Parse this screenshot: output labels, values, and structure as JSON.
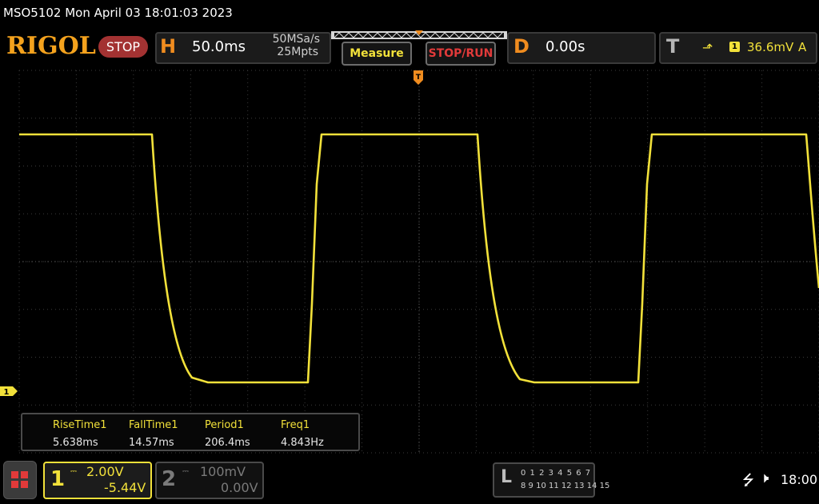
{
  "header": {
    "title": "MSO5102  Mon April 03 18:01:03 2023",
    "logo": "RIGOL",
    "run_state": "STOP"
  },
  "horizontal": {
    "letter": "H",
    "timebase": "50.0ms",
    "sample_rate": "50MSa/s",
    "memory_depth": "25Mpts"
  },
  "buttons": {
    "measure": "Measure",
    "stop_run": "STOP/RUN"
  },
  "delay": {
    "letter": "D",
    "value": "0.00s"
  },
  "trigger": {
    "letter": "T",
    "slope_icon": "rising-edge-icon",
    "slope_glyph": "⬏",
    "source": "1",
    "level": "36.6mV",
    "mode": "A"
  },
  "screen": {
    "ch1_marker": "1",
    "trigger_marker": "T",
    "trace_color": "#f2e13a"
  },
  "measurements": [
    {
      "name": "RiseTime1",
      "value": "5.638ms"
    },
    {
      "name": "FallTime1",
      "value": "14.57ms"
    },
    {
      "name": "Period1",
      "value": "206.4ms"
    },
    {
      "name": "Freq1",
      "value": "4.843Hz"
    }
  ],
  "channels": {
    "ch1": {
      "number": "1",
      "coupling": "⎓",
      "scale": "2.00V",
      "offset": "-5.44V",
      "color": "#f2e13a"
    },
    "ch2": {
      "number": "2",
      "coupling": "⎓",
      "scale": "100mV",
      "offset": "0.00V",
      "color": "#7a7a7a"
    }
  },
  "logic_analyzer": {
    "letter": "L",
    "row1": "0 1 2 3   4 5 6 7",
    "row2": "8 9 10 11  12 13 14 15"
  },
  "status": {
    "usb_icon": "usb-icon",
    "speaker_icon": "speaker-muted-icon",
    "time": "18:00"
  }
}
